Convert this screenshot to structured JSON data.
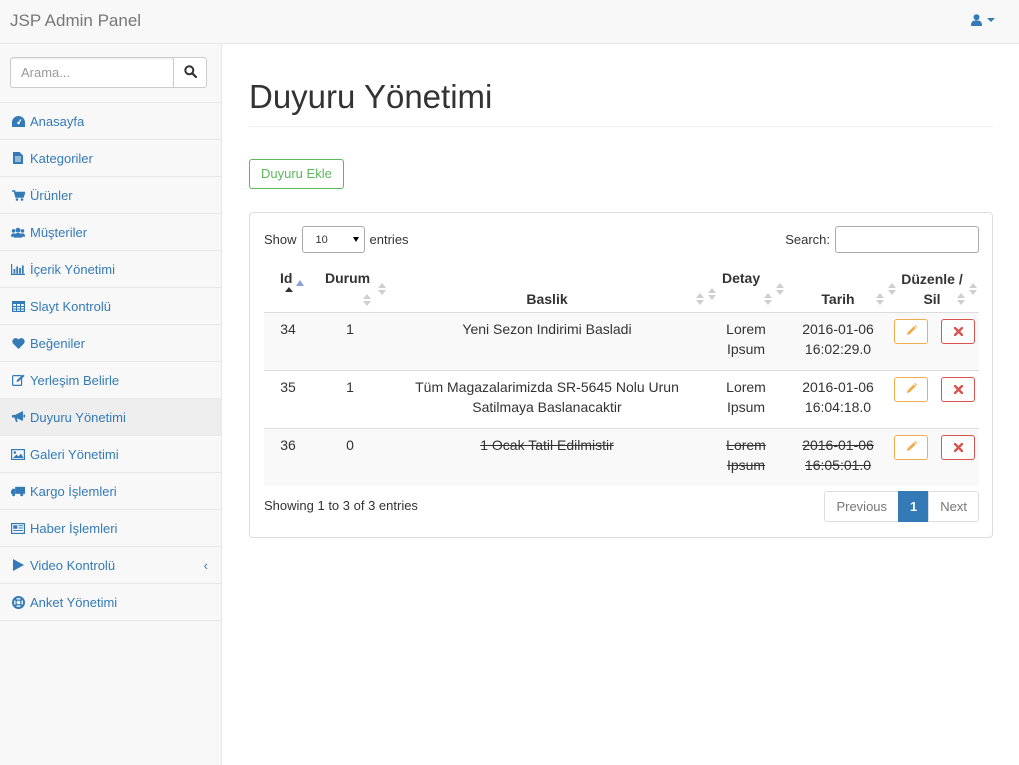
{
  "app": {
    "brand": "JSP Admin Panel"
  },
  "sidebar": {
    "search_placeholder": "Arama...",
    "items": [
      {
        "label": "Anasayfa",
        "icon": "dashboard-icon"
      },
      {
        "label": "Kategoriler",
        "icon": "file-icon"
      },
      {
        "label": "Ürünler",
        "icon": "cart-icon"
      },
      {
        "label": "Müşteriler",
        "icon": "users-icon"
      },
      {
        "label": "İçerik Yönetimi",
        "icon": "bar-chart-icon"
      },
      {
        "label": "Slayt Kontrolü",
        "icon": "table-icon"
      },
      {
        "label": "Beğeniler",
        "icon": "heart-icon"
      },
      {
        "label": "Yerleşim Belirle",
        "icon": "edit-icon"
      },
      {
        "label": "Duyuru Yönetimi",
        "icon": "bullhorn-icon",
        "active": true
      },
      {
        "label": "Galeri Yönetimi",
        "icon": "image-icon"
      },
      {
        "label": "Kargo İşlemleri",
        "icon": "truck-icon"
      },
      {
        "label": "Haber İşlemleri",
        "icon": "newspaper-icon"
      },
      {
        "label": "Video Kontrolü",
        "icon": "play-icon",
        "arrow": "‹"
      },
      {
        "label": "Anket Yönetimi",
        "icon": "life-ring-icon"
      }
    ]
  },
  "main": {
    "title": "Duyuru Yönetimi",
    "add_button": "Duyuru Ekle",
    "table": {
      "show_label": "Show",
      "entries_label": "entries",
      "length_value": "10",
      "search_label": "Search:",
      "columns": [
        "Id",
        "Durum",
        "Baslik",
        "Detay",
        "Tarih",
        "Düzenle / Sil"
      ],
      "rows": [
        {
          "id": "34",
          "durum": "1",
          "baslik": "Yeni Sezon Indirimi Basladi",
          "detay": "Lorem Ipsum",
          "tarih": "2016-01-06 16:02:29.0",
          "strike": false
        },
        {
          "id": "35",
          "durum": "1",
          "baslik": "Tüm Magazalarimizda SR-5645 Nolu Urun Satilmaya Baslanacaktir",
          "detay": "Lorem Ipsum",
          "tarih": "2016-01-06 16:04:18.0",
          "strike": false
        },
        {
          "id": "36",
          "durum": "0",
          "baslik": "1 Ocak Tatil Edilmistir",
          "detay": "Lorem Ipsum",
          "tarih": "2016-01-06 16:05:01.0",
          "strike": true
        }
      ],
      "info": "Showing 1 to 3 of 3 entries",
      "pager": {
        "previous": "Previous",
        "current": "1",
        "next": "Next"
      }
    }
  },
  "colors": {
    "link": "#337ab7",
    "success": "#5cb85c",
    "warning": "#f0ad4e",
    "danger": "#d9534f"
  }
}
